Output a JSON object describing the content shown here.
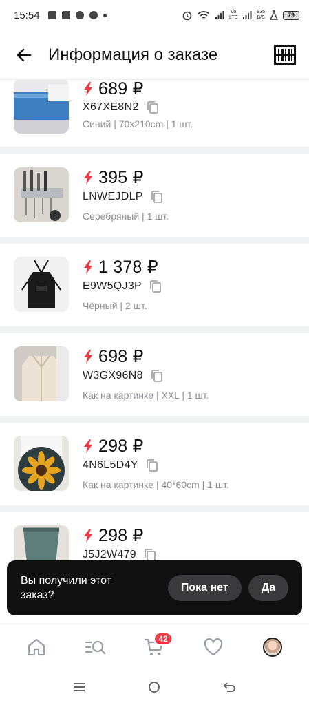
{
  "status_bar": {
    "time": "15:54",
    "net_speed_value": "935",
    "net_speed_unit": "B/S",
    "network_label_top": "Vo",
    "network_label_bottom": "LTE",
    "battery": "79"
  },
  "header": {
    "title": "Информация о заказе",
    "back_icon": "arrow-left-icon",
    "barcode_icon": "barcode-icon"
  },
  "items": [
    {
      "price": "689 ₽",
      "sku": "X67XE8N2",
      "meta": "Синий | 70x210cm | 1 шт."
    },
    {
      "price": "395 ₽",
      "sku": "LNWEJDLP",
      "meta": "Серебряный | 1 шт."
    },
    {
      "price": "1 378 ₽",
      "sku": "E9W5QJ3P",
      "meta": "Чёрный | 2 шт."
    },
    {
      "price": "698 ₽",
      "sku": "W3GX96N8",
      "meta": "Как на картинке | XXL | 1 шт."
    },
    {
      "price": "298 ₽",
      "sku": "4N6L5D4Y",
      "meta": "Как на картинке | 40*60cm | 1 шт."
    },
    {
      "price": "298 ₽",
      "sku": "J5J2W479",
      "meta": ""
    }
  ],
  "prompt": {
    "text": "Вы получили этот заказ?",
    "no_label": "Пока нет",
    "yes_label": "Да"
  },
  "bottom_nav": {
    "cart_badge": "42",
    "icons": [
      "home-icon",
      "catalog-search-icon",
      "cart-icon",
      "heart-icon",
      "profile-avatar"
    ]
  },
  "colors": {
    "accent_red": "#ef3a45",
    "separator": "#f1f2f4",
    "prompt_bg": "#111111"
  }
}
